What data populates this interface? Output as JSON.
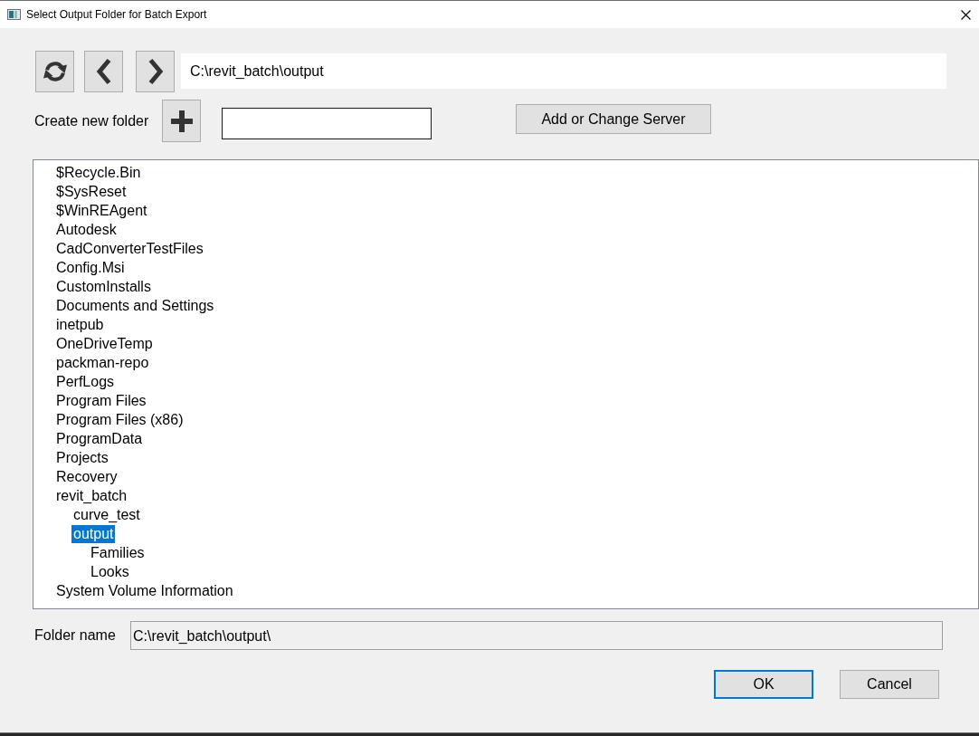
{
  "window": {
    "title": "Select Output Folder for Batch Export"
  },
  "path_field": {
    "value": "C:\\revit_batch\\output"
  },
  "new_folder": {
    "label": "Create new folder"
  },
  "server_button": {
    "label": "Add or Change Server"
  },
  "tree": {
    "items": [
      {
        "name": "$Recycle.Bin",
        "selected": false
      },
      {
        "name": "$SysReset",
        "selected": false
      },
      {
        "name": "$WinREAgent",
        "selected": false
      },
      {
        "name": "Autodesk",
        "selected": false
      },
      {
        "name": "CadConverterTestFiles",
        "selected": false
      },
      {
        "name": "Config.Msi",
        "selected": false
      },
      {
        "name": "CustomInstalls",
        "selected": false
      },
      {
        "name": "Documents and Settings",
        "selected": false
      },
      {
        "name": "inetpub",
        "selected": false
      },
      {
        "name": "OneDriveTemp",
        "selected": false
      },
      {
        "name": "packman-repo",
        "selected": false
      },
      {
        "name": "PerfLogs",
        "selected": false
      },
      {
        "name": "Program Files",
        "selected": false
      },
      {
        "name": "Program Files (x86)",
        "selected": false
      },
      {
        "name": "ProgramData",
        "selected": false
      },
      {
        "name": "Projects",
        "selected": false
      },
      {
        "name": "Recovery",
        "selected": false
      },
      {
        "name": "revit_batch",
        "selected": false,
        "children": [
          {
            "name": "curve_test",
            "selected": false
          },
          {
            "name": "output",
            "selected": true,
            "children": [
              {
                "name": "Families",
                "selected": false
              },
              {
                "name": "Looks",
                "selected": false
              }
            ]
          }
        ]
      },
      {
        "name": "System Volume Information",
        "selected": false
      }
    ]
  },
  "folder_name": {
    "label": "Folder name",
    "value": "C:\\revit_batch\\output\\",
    "read_only": true
  },
  "buttons": [
    {
      "label": "OK",
      "default": true
    },
    {
      "label": "Cancel",
      "default": false
    }
  ]
}
